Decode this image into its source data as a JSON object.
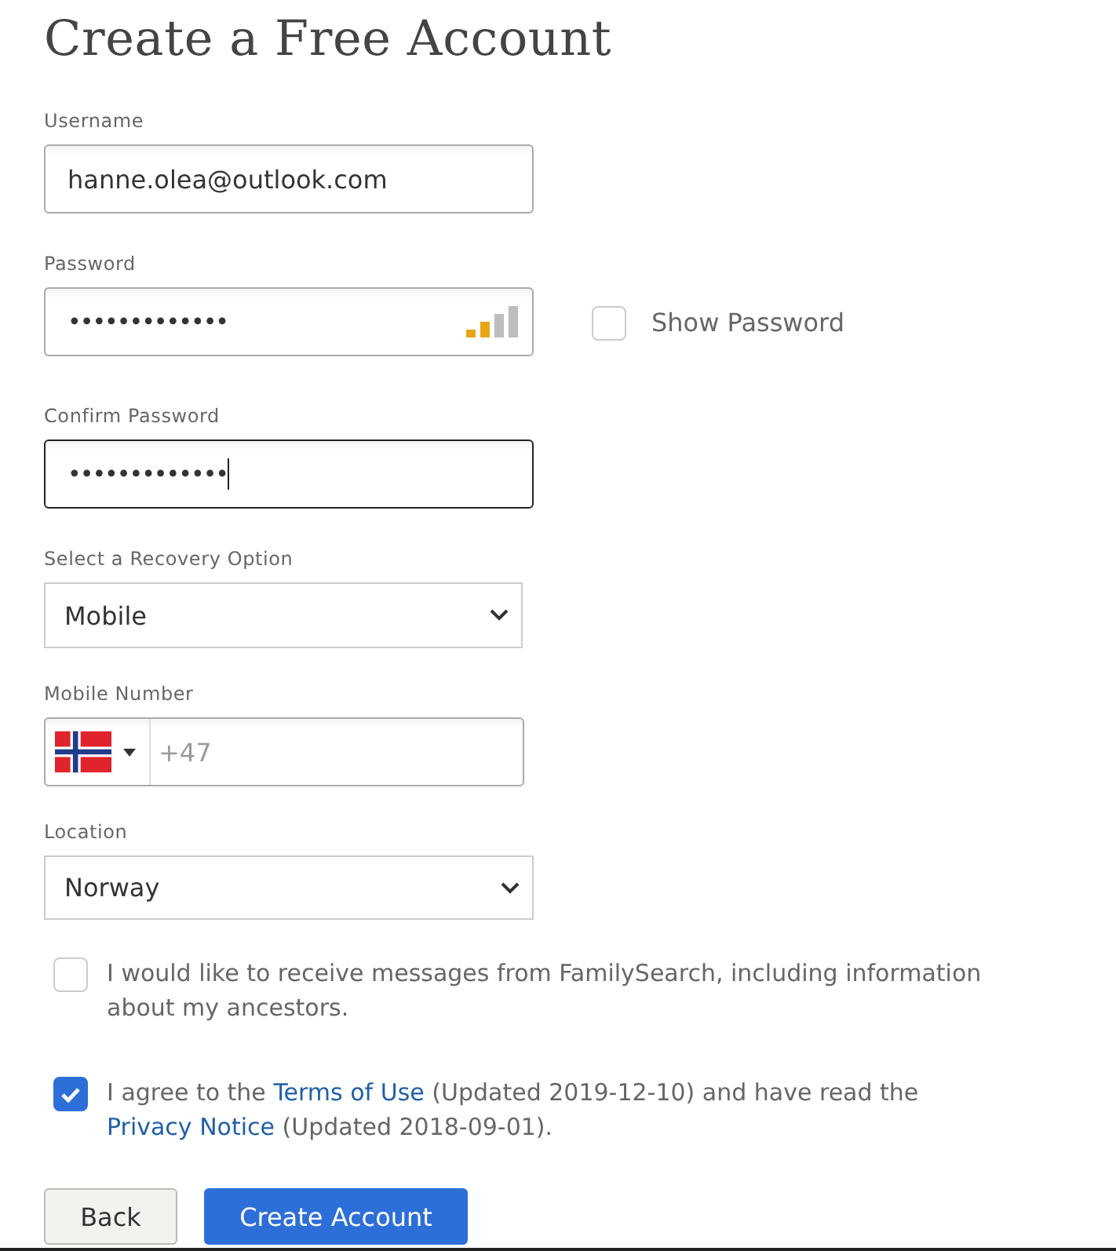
{
  "title": "Create a Free Account",
  "fields": [
    {
      "kind": "text",
      "label": "Username",
      "value": "hanne.olea@outlook.com",
      "focused": false
    },
    {
      "kind": "password",
      "label": "Password",
      "value": "•••••••••••••",
      "focused": false,
      "strength": {
        "level": 0.5
      },
      "toggle": {
        "label": "Show Password",
        "checked": false
      }
    },
    {
      "kind": "password",
      "label": "Confirm Password",
      "value": "•••••••••••••",
      "focused": true
    },
    {
      "kind": "select",
      "label": "Select a Recovery Option",
      "value": "Mobile"
    },
    {
      "kind": "phone",
      "label": "Mobile Number",
      "placeholder": "+47"
    },
    {
      "kind": "select",
      "label": "Location",
      "value": "Norway"
    }
  ],
  "consents": [
    {
      "checked": false,
      "segments": [
        {
          "kind": "text",
          "text": "I would like to receive messages from FamilySearch, including information about my ancestors."
        }
      ]
    },
    {
      "checked": true,
      "segments": [
        {
          "kind": "text",
          "text": "I agree to the "
        },
        {
          "kind": "link",
          "text": "Terms of Use"
        },
        {
          "kind": "text",
          "text": " (Updated 2019-12-10) and have read the "
        },
        {
          "kind": "link",
          "text": "Privacy Notice"
        },
        {
          "kind": "text",
          "text": " (Updated 2018-09-01)."
        }
      ]
    }
  ],
  "buttons": [
    {
      "label": "Back",
      "kind": "secondary"
    },
    {
      "label": "Create Account",
      "kind": "primary"
    }
  ]
}
